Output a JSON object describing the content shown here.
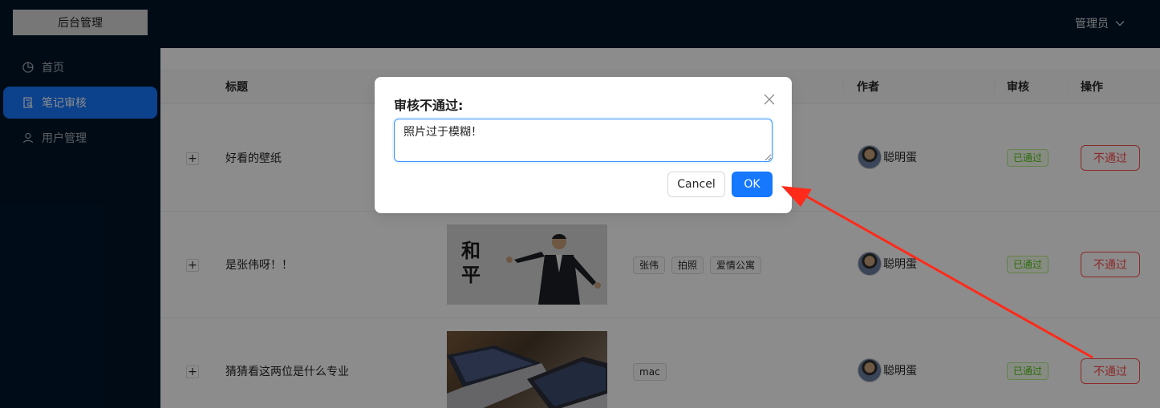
{
  "header": {
    "logo": "后台管理",
    "user": "管理员"
  },
  "sidebar": {
    "items": [
      {
        "label": "首页",
        "icon": "pie-chart-icon"
      },
      {
        "label": "笔记审核",
        "icon": "audit-icon",
        "active": true
      },
      {
        "label": "用户管理",
        "icon": "user-icon"
      }
    ]
  },
  "table": {
    "columns": [
      "标题",
      "作者",
      "审核",
      "操作"
    ],
    "rows": [
      {
        "expand": "+",
        "title": "好看的壁纸",
        "tags": [],
        "author": "聪明蛋",
        "status": "已通过",
        "action": "不通过"
      },
      {
        "expand": "+",
        "title": "是张伟呀！！",
        "image_text": "和\n平",
        "tags": [
          "张伟",
          "拍照",
          "爱情公寓"
        ],
        "author": "聪明蛋",
        "status": "已通过",
        "action": "不通过"
      },
      {
        "expand": "+",
        "title": "猜猜看这两位是什么专业",
        "tags": [
          "mac"
        ],
        "author": "聪明蛋",
        "status": "已通过",
        "action": "不通过"
      }
    ]
  },
  "modal": {
    "title": "审核不通过:",
    "textarea_value": "照片过于模糊！",
    "cancel": "Cancel",
    "ok": "OK"
  },
  "colors": {
    "primary": "#1677ff",
    "danger": "#ff4d4f",
    "success": "#52c41a",
    "arrow": "#ff2a1a",
    "sidebar": "#001529"
  }
}
